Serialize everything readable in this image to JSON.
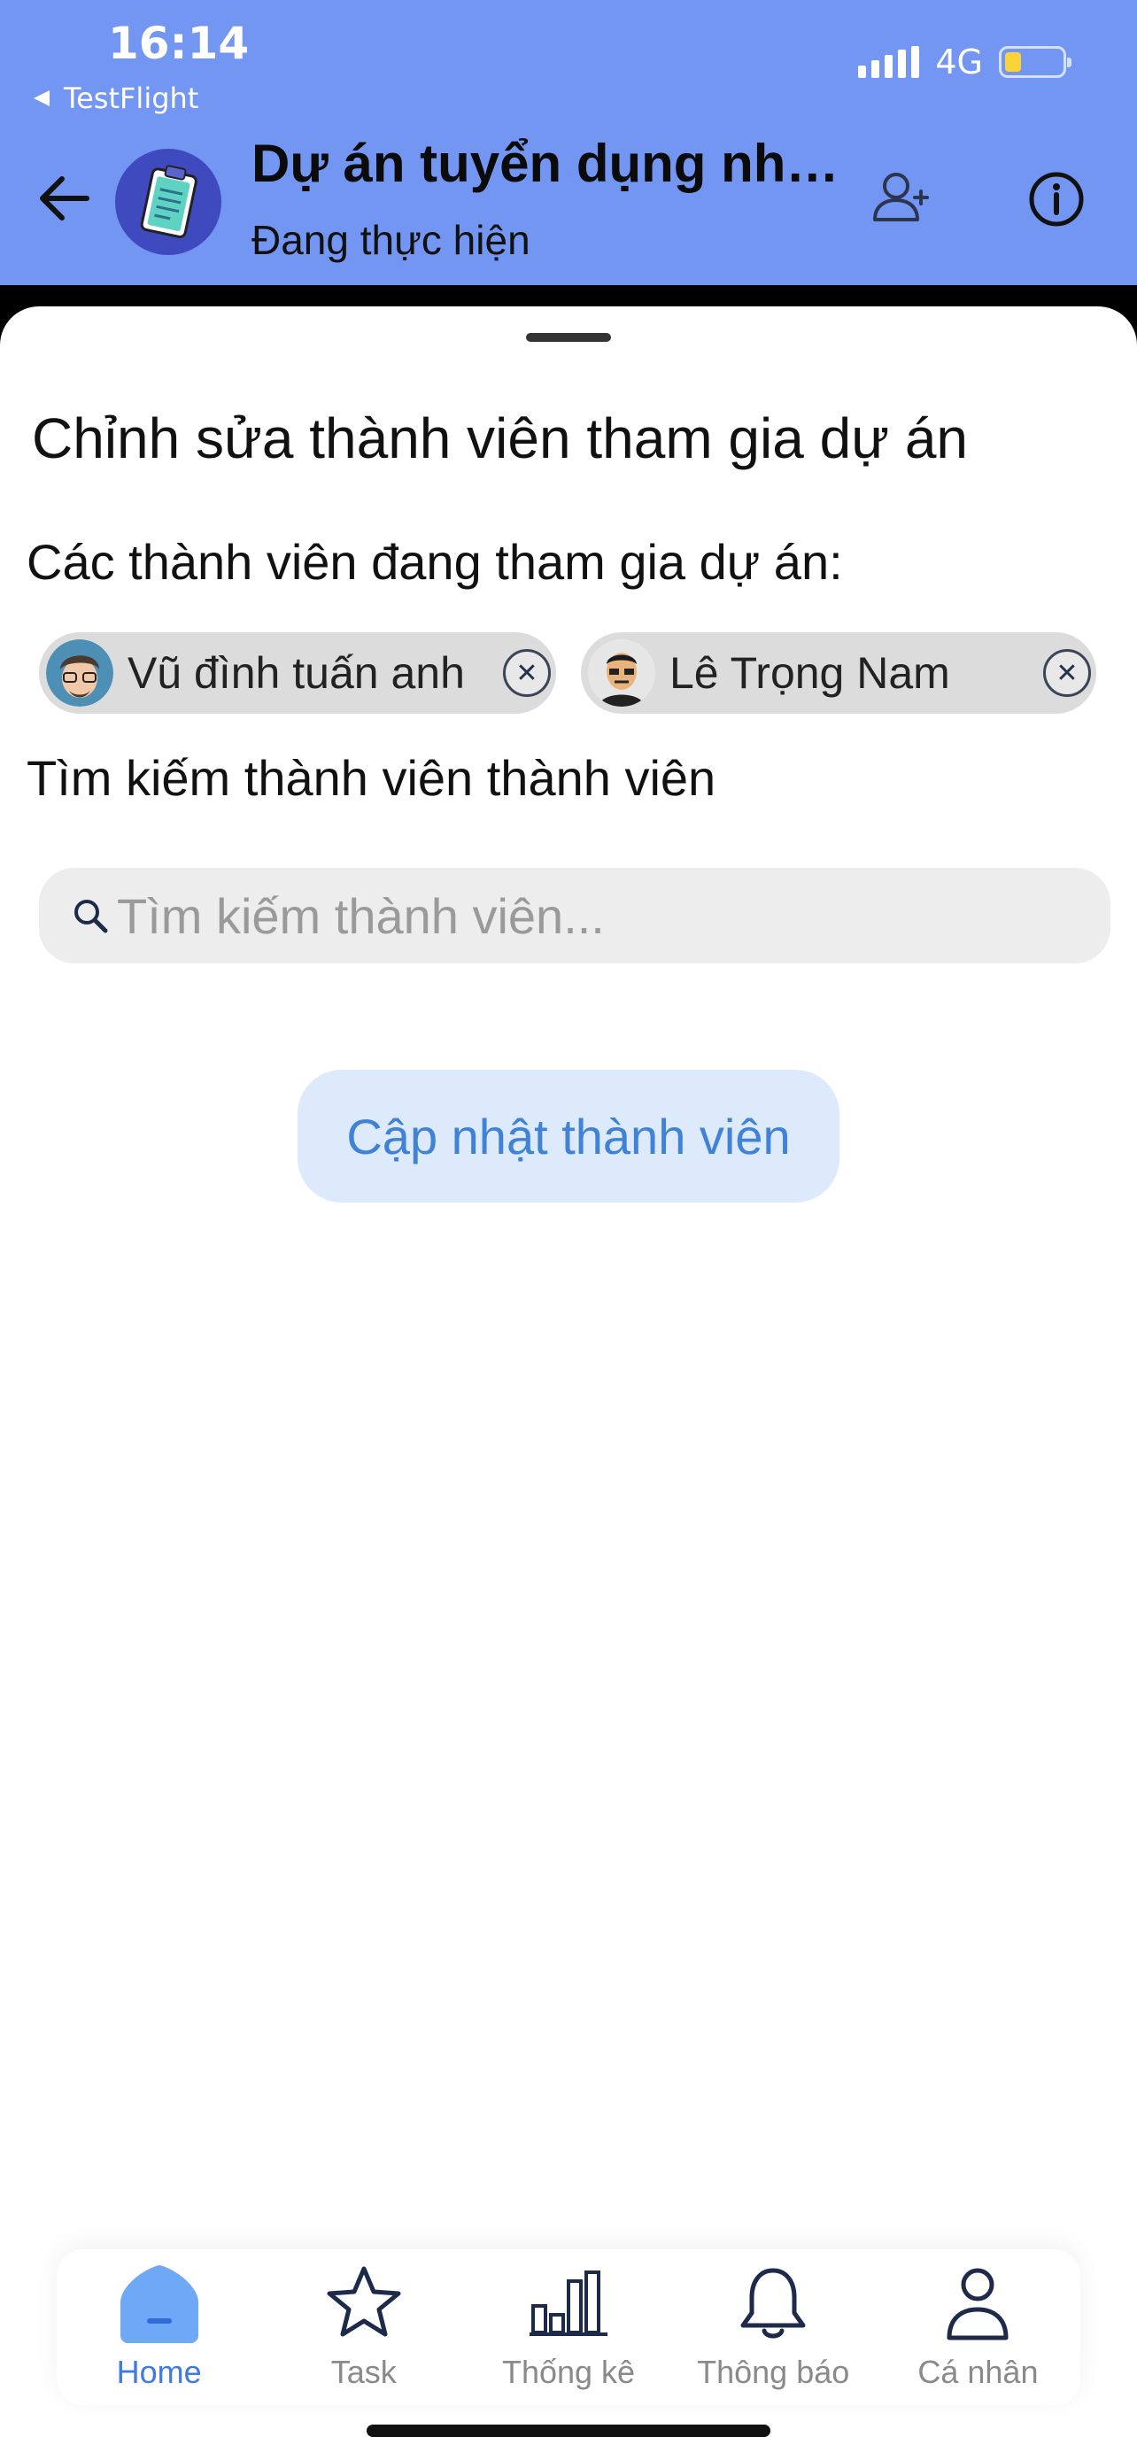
{
  "status_bar": {
    "time": "16:14",
    "back_app": "TestFlight",
    "network": "4G"
  },
  "header": {
    "title": "Dự án tuyển dụng nhâ...",
    "subtitle": "Đang thực hiện"
  },
  "sheet": {
    "title": "Chỉnh sửa thành viên tham gia dự án",
    "members_label": "Các thành viên đang tham gia dự án:",
    "members": [
      {
        "name": "Vũ đình tuấn anh",
        "remove_icon": "close-icon"
      },
      {
        "name": "Lê Trọng Nam",
        "remove_icon": "close-icon"
      }
    ],
    "search_label": "Tìm kiếm thành viên thành viên",
    "search_placeholder": "Tìm kiếm thành viên...",
    "update_button": "Cập nhật thành viên"
  },
  "tabs": [
    {
      "label": "Home",
      "icon": "home-icon",
      "active": true
    },
    {
      "label": "Task",
      "icon": "star-icon",
      "active": false
    },
    {
      "label": "Thống kê",
      "icon": "chart-icon",
      "active": false
    },
    {
      "label": "Thông báo",
      "icon": "bell-icon",
      "active": false
    },
    {
      "label": "Cá nhân",
      "icon": "person-icon",
      "active": false
    }
  ],
  "colors": {
    "header_bg": "#7396F2",
    "accent": "#3F7BE0",
    "button_bg": "#DCEAFB",
    "chip_bg": "#DCDCDC"
  }
}
